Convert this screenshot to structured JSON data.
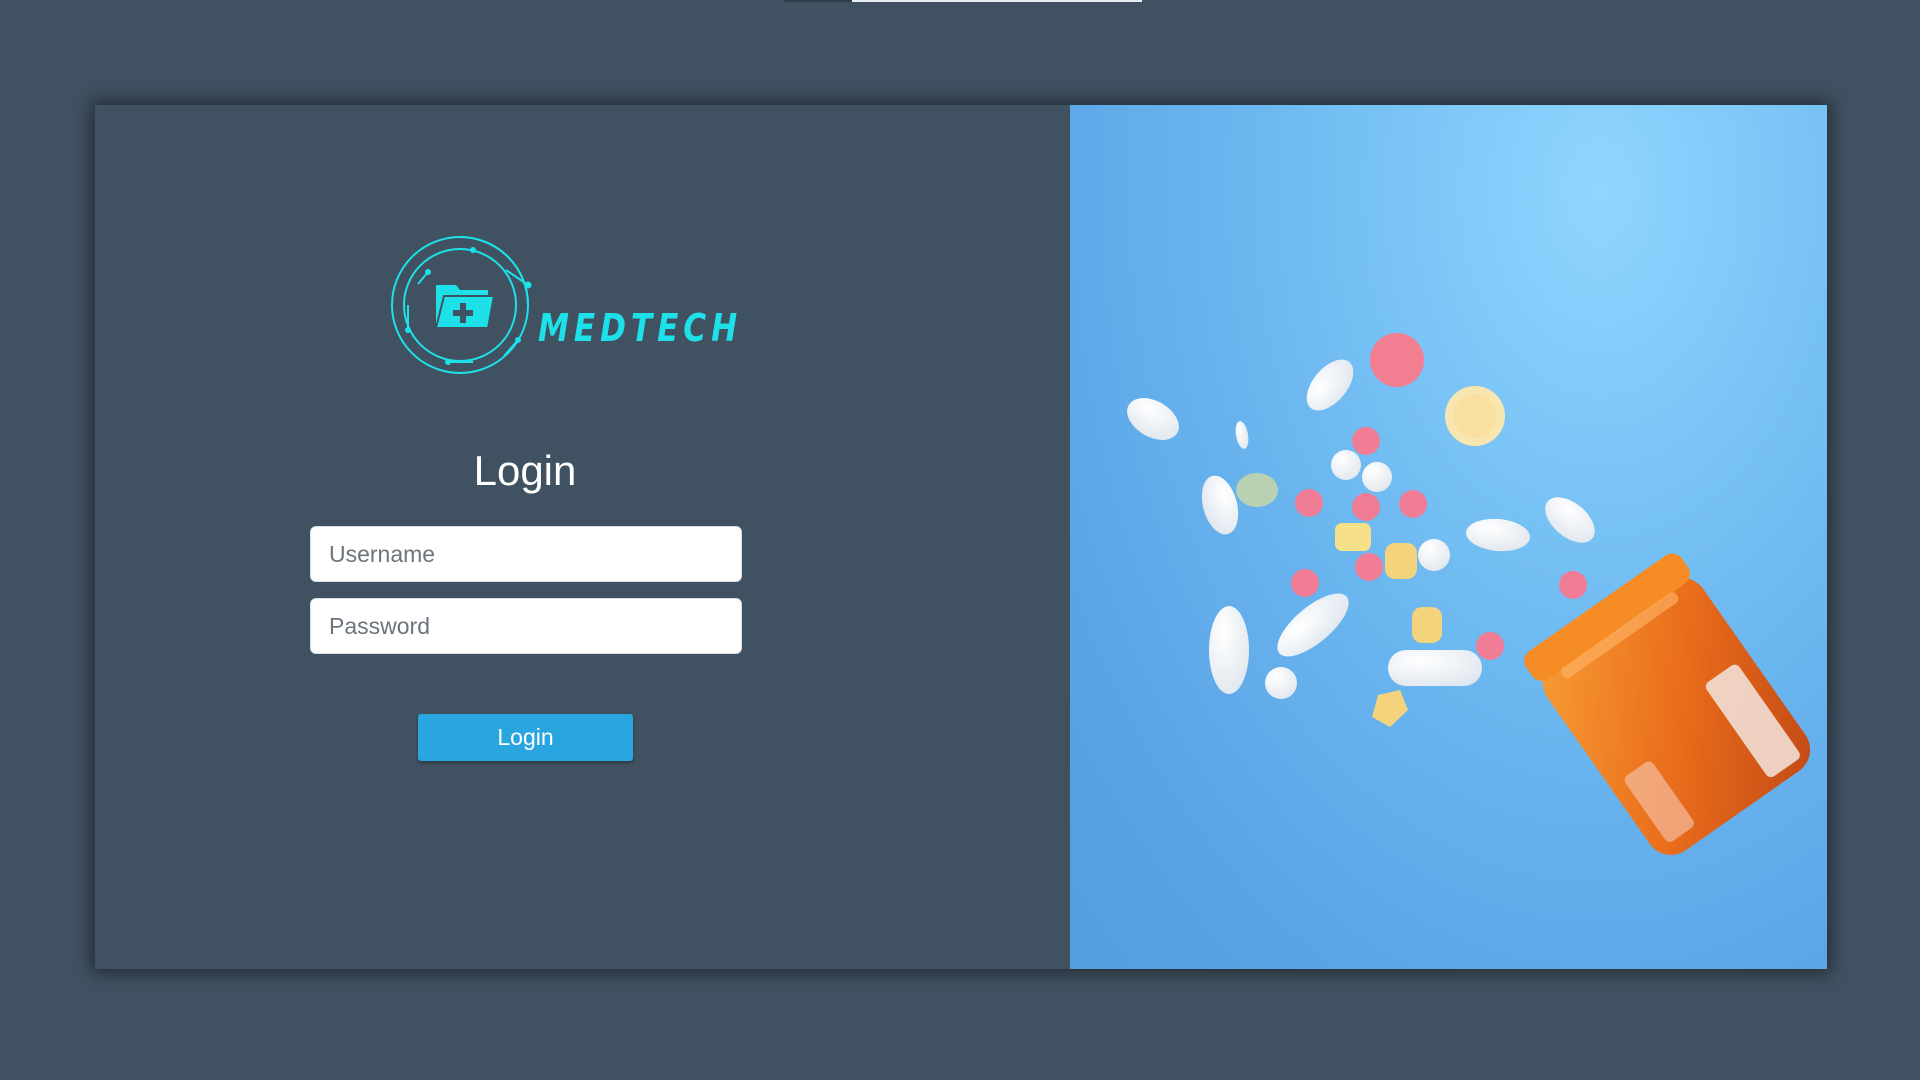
{
  "brand": {
    "name": "MEDTECH",
    "logo_icon": "medical-folder-circuit-icon",
    "accent_color": "#1de0e8"
  },
  "login_form": {
    "title": "Login",
    "username": {
      "placeholder": "Username",
      "value": ""
    },
    "password": {
      "placeholder": "Password",
      "value": ""
    },
    "submit_label": "Login",
    "button_color": "#29a5e0"
  },
  "hero_image": {
    "subject": "pills-spilling-from-orange-bottle-image",
    "background_color": "#6cb8f0"
  },
  "colors": {
    "page_background": "#405161",
    "panel_background": "#405161"
  }
}
